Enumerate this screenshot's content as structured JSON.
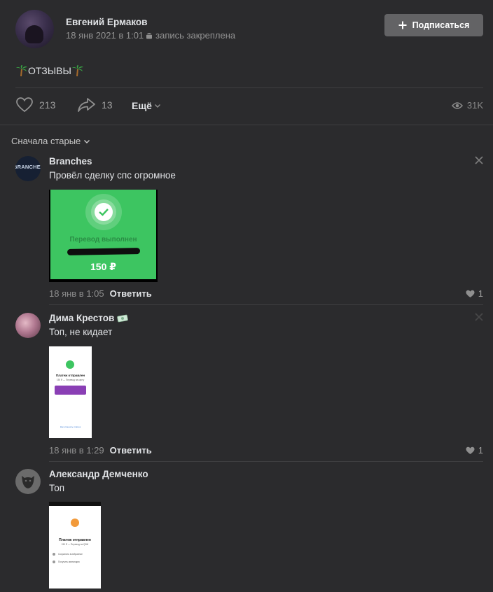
{
  "post": {
    "author": "Евгений Ермаков",
    "date": "18 янв 2021 в 1:01",
    "pinned": "запись закреплена",
    "subscribe_label": "Подписаться",
    "text": "ОТЗЫВЫ",
    "likes": "213",
    "shares": "13",
    "more_label": "Ещё",
    "views": "31K"
  },
  "comments_sort": "Сначала старые",
  "comments": [
    {
      "name": "Branches",
      "avatar_text": "BRANCHES",
      "text": "Провёл сделку спс огромное",
      "attachment": {
        "label": "Перевод выполнен",
        "amount": "150 ₽"
      },
      "time": "18 янв в 1:05",
      "reply_label": "Ответить",
      "likes": "1"
    },
    {
      "name": "Дима Крестов",
      "text": "Топ, не кидает",
      "attachment": {
        "title": "Платеж отправлен",
        "subtitle": "150 ₽ — Перевод на карту",
        "link": "Как отменить платеж"
      },
      "time": "18 янв в 1:29",
      "reply_label": "Ответить",
      "likes": "1"
    },
    {
      "name": "Александр Демченко",
      "text": "Топ",
      "attachment": {
        "title": "Платеж отправлен",
        "subtitle": "150 ₽ — Перевод на QIWI",
        "row1": "Сохранить в избранное",
        "row2": "Получить квитанцию"
      }
    }
  ],
  "colors": {
    "background": "#2b2b2d",
    "button": "#636365",
    "green_card": "#3dc561",
    "banner_purple": "#8a3fb5"
  }
}
